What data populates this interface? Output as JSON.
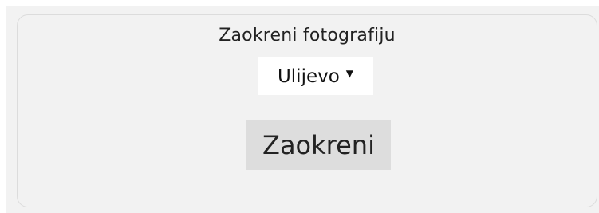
{
  "form": {
    "label": "Zaokreni fotografiju",
    "select": {
      "selected": "Ulijevo",
      "arrow_icon": "triangle-down-icon"
    },
    "button_label": "Zaokreni"
  }
}
